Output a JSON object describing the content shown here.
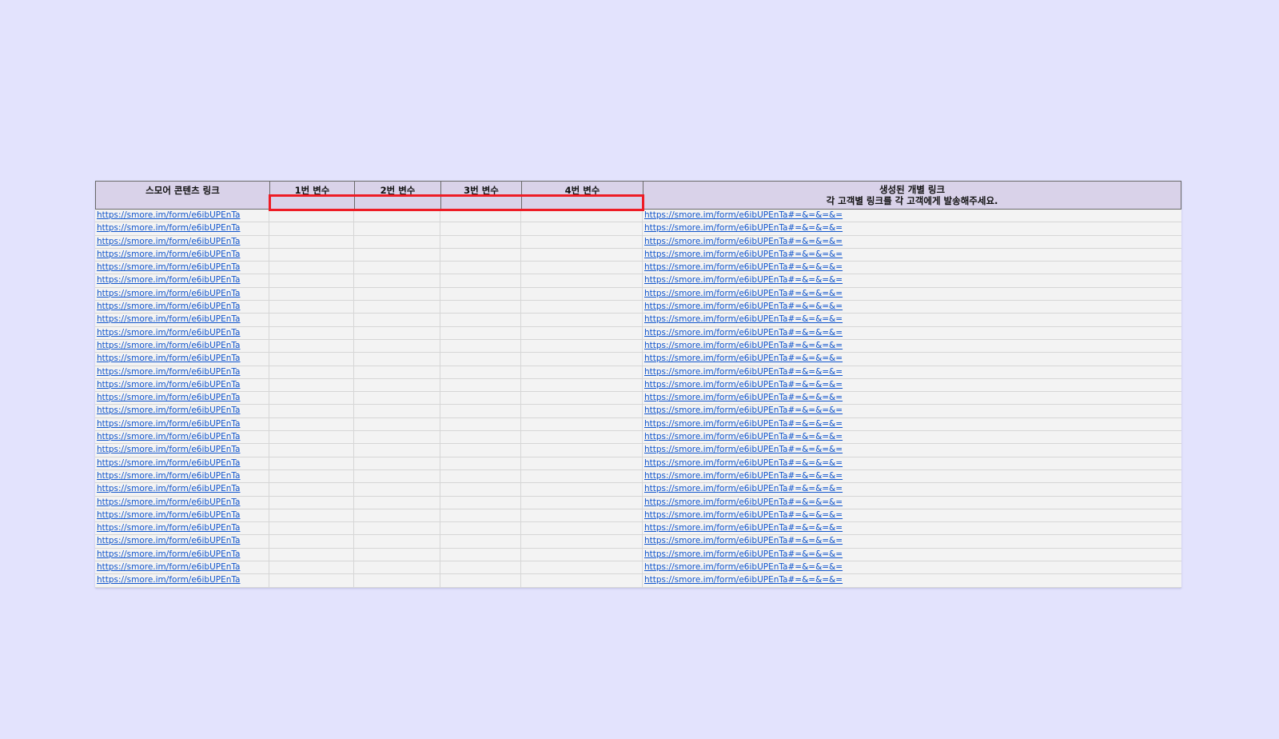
{
  "colors": {
    "page_background": "#e3e3fd",
    "header_background": "#d9d2e9",
    "link": "#1155cc",
    "highlight_box": "#ee1c25"
  },
  "table": {
    "headers": {
      "content_link": "스모어 콘텐츠 링크",
      "var1": "1번 변수",
      "var2": "2번 변수",
      "var3": "3번 변수",
      "var4": "4번 변수",
      "generated_link_line1": "생성된 개별 링크",
      "generated_link_line2": "각 고객별 링크를 각 고객에게 발송해주세요."
    },
    "rows": [
      {
        "content_link": "https://smore.im/form/e6ibUPEnTa",
        "var1": "",
        "var2": "",
        "var3": "",
        "var4": "",
        "generated_link": "https://smore.im/form/e6ibUPEnTa#=&=&=&="
      },
      {
        "content_link": "https://smore.im/form/e6ibUPEnTa",
        "var1": "",
        "var2": "",
        "var3": "",
        "var4": "",
        "generated_link": "https://smore.im/form/e6ibUPEnTa#=&=&=&="
      },
      {
        "content_link": "https://smore.im/form/e6ibUPEnTa",
        "var1": "",
        "var2": "",
        "var3": "",
        "var4": "",
        "generated_link": "https://smore.im/form/e6ibUPEnTa#=&=&=&="
      },
      {
        "content_link": "https://smore.im/form/e6ibUPEnTa",
        "var1": "",
        "var2": "",
        "var3": "",
        "var4": "",
        "generated_link": "https://smore.im/form/e6ibUPEnTa#=&=&=&="
      },
      {
        "content_link": "https://smore.im/form/e6ibUPEnTa",
        "var1": "",
        "var2": "",
        "var3": "",
        "var4": "",
        "generated_link": "https://smore.im/form/e6ibUPEnTa#=&=&=&="
      },
      {
        "content_link": "https://smore.im/form/e6ibUPEnTa",
        "var1": "",
        "var2": "",
        "var3": "",
        "var4": "",
        "generated_link": "https://smore.im/form/e6ibUPEnTa#=&=&=&="
      },
      {
        "content_link": "https://smore.im/form/e6ibUPEnTa",
        "var1": "",
        "var2": "",
        "var3": "",
        "var4": "",
        "generated_link": "https://smore.im/form/e6ibUPEnTa#=&=&=&="
      },
      {
        "content_link": "https://smore.im/form/e6ibUPEnTa",
        "var1": "",
        "var2": "",
        "var3": "",
        "var4": "",
        "generated_link": "https://smore.im/form/e6ibUPEnTa#=&=&=&="
      },
      {
        "content_link": "https://smore.im/form/e6ibUPEnTa",
        "var1": "",
        "var2": "",
        "var3": "",
        "var4": "",
        "generated_link": "https://smore.im/form/e6ibUPEnTa#=&=&=&="
      },
      {
        "content_link": "https://smore.im/form/e6ibUPEnTa",
        "var1": "",
        "var2": "",
        "var3": "",
        "var4": "",
        "generated_link": "https://smore.im/form/e6ibUPEnTa#=&=&=&="
      },
      {
        "content_link": "https://smore.im/form/e6ibUPEnTa",
        "var1": "",
        "var2": "",
        "var3": "",
        "var4": "",
        "generated_link": "https://smore.im/form/e6ibUPEnTa#=&=&=&="
      },
      {
        "content_link": "https://smore.im/form/e6ibUPEnTa",
        "var1": "",
        "var2": "",
        "var3": "",
        "var4": "",
        "generated_link": "https://smore.im/form/e6ibUPEnTa#=&=&=&="
      },
      {
        "content_link": "https://smore.im/form/e6ibUPEnTa",
        "var1": "",
        "var2": "",
        "var3": "",
        "var4": "",
        "generated_link": "https://smore.im/form/e6ibUPEnTa#=&=&=&="
      },
      {
        "content_link": "https://smore.im/form/e6ibUPEnTa",
        "var1": "",
        "var2": "",
        "var3": "",
        "var4": "",
        "generated_link": "https://smore.im/form/e6ibUPEnTa#=&=&=&="
      },
      {
        "content_link": "https://smore.im/form/e6ibUPEnTa",
        "var1": "",
        "var2": "",
        "var3": "",
        "var4": "",
        "generated_link": "https://smore.im/form/e6ibUPEnTa#=&=&=&="
      },
      {
        "content_link": "https://smore.im/form/e6ibUPEnTa",
        "var1": "",
        "var2": "",
        "var3": "",
        "var4": "",
        "generated_link": "https://smore.im/form/e6ibUPEnTa#=&=&=&="
      },
      {
        "content_link": "https://smore.im/form/e6ibUPEnTa",
        "var1": "",
        "var2": "",
        "var3": "",
        "var4": "",
        "generated_link": "https://smore.im/form/e6ibUPEnTa#=&=&=&="
      },
      {
        "content_link": "https://smore.im/form/e6ibUPEnTa",
        "var1": "",
        "var2": "",
        "var3": "",
        "var4": "",
        "generated_link": "https://smore.im/form/e6ibUPEnTa#=&=&=&="
      },
      {
        "content_link": "https://smore.im/form/e6ibUPEnTa",
        "var1": "",
        "var2": "",
        "var3": "",
        "var4": "",
        "generated_link": "https://smore.im/form/e6ibUPEnTa#=&=&=&="
      },
      {
        "content_link": "https://smore.im/form/e6ibUPEnTa",
        "var1": "",
        "var2": "",
        "var3": "",
        "var4": "",
        "generated_link": "https://smore.im/form/e6ibUPEnTa#=&=&=&="
      },
      {
        "content_link": "https://smore.im/form/e6ibUPEnTa",
        "var1": "",
        "var2": "",
        "var3": "",
        "var4": "",
        "generated_link": "https://smore.im/form/e6ibUPEnTa#=&=&=&="
      },
      {
        "content_link": "https://smore.im/form/e6ibUPEnTa",
        "var1": "",
        "var2": "",
        "var3": "",
        "var4": "",
        "generated_link": "https://smore.im/form/e6ibUPEnTa#=&=&=&="
      },
      {
        "content_link": "https://smore.im/form/e6ibUPEnTa",
        "var1": "",
        "var2": "",
        "var3": "",
        "var4": "",
        "generated_link": "https://smore.im/form/e6ibUPEnTa#=&=&=&="
      },
      {
        "content_link": "https://smore.im/form/e6ibUPEnTa",
        "var1": "",
        "var2": "",
        "var3": "",
        "var4": "",
        "generated_link": "https://smore.im/form/e6ibUPEnTa#=&=&=&="
      },
      {
        "content_link": "https://smore.im/form/e6ibUPEnTa",
        "var1": "",
        "var2": "",
        "var3": "",
        "var4": "",
        "generated_link": "https://smore.im/form/e6ibUPEnTa#=&=&=&="
      },
      {
        "content_link": "https://smore.im/form/e6ibUPEnTa",
        "var1": "",
        "var2": "",
        "var3": "",
        "var4": "",
        "generated_link": "https://smore.im/form/e6ibUPEnTa#=&=&=&="
      },
      {
        "content_link": "https://smore.im/form/e6ibUPEnTa",
        "var1": "",
        "var2": "",
        "var3": "",
        "var4": "",
        "generated_link": "https://smore.im/form/e6ibUPEnTa#=&=&=&="
      },
      {
        "content_link": "https://smore.im/form/e6ibUPEnTa",
        "var1": "",
        "var2": "",
        "var3": "",
        "var4": "",
        "generated_link": "https://smore.im/form/e6ibUPEnTa#=&=&=&="
      },
      {
        "content_link": "https://smore.im/form/e6ibUPEnTa",
        "var1": "",
        "var2": "",
        "var3": "",
        "var4": "",
        "generated_link": "https://smore.im/form/e6ibUPEnTa#=&=&=&="
      }
    ]
  }
}
